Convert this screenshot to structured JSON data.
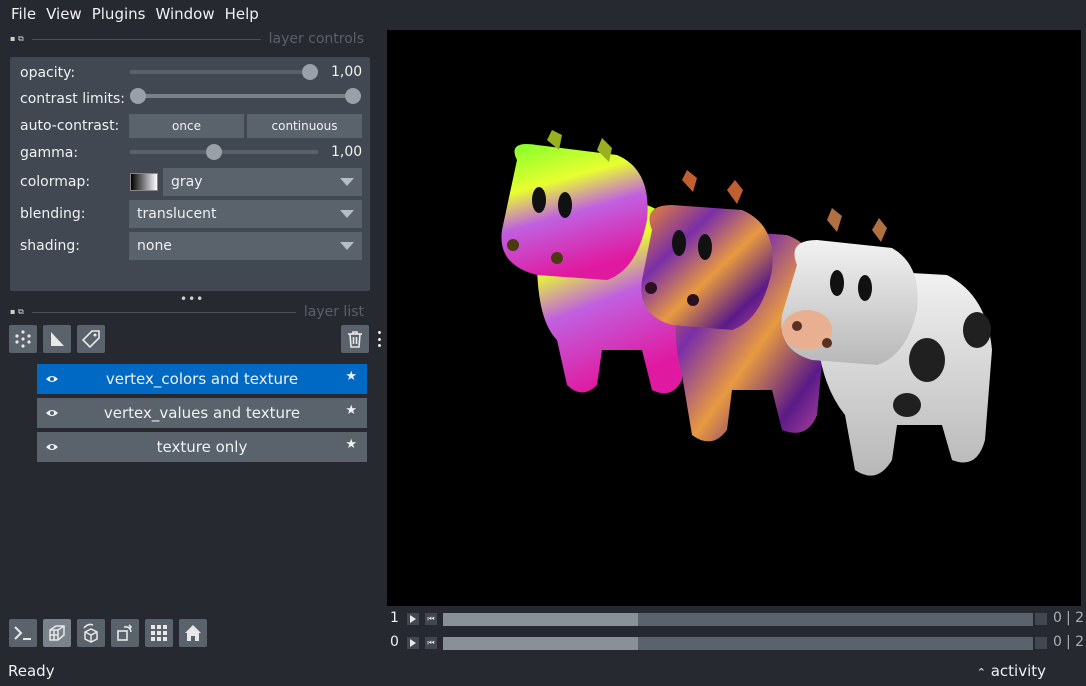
{
  "menu": [
    "File",
    "View",
    "Plugins",
    "Window",
    "Help"
  ],
  "layer_controls": {
    "title": "layer controls",
    "opacity_label": "opacity:",
    "opacity_value": "1,00",
    "opacity_level": 1.0,
    "contrast_label": "contrast limits:",
    "auto_contrast_label": "auto-contrast:",
    "once_label": "once",
    "continuous_label": "continuous",
    "gamma_label": "gamma:",
    "gamma_value": "1,00",
    "colormap_label": "colormap:",
    "colormap_value": "gray",
    "blending_label": "blending:",
    "blending_value": "translucent",
    "shading_label": "shading:",
    "shading_value": "none"
  },
  "layer_list": {
    "title": "layer list",
    "layers": [
      {
        "name": "vertex_colors and texture",
        "selected": true
      },
      {
        "name": "vertex_values and texture",
        "selected": false
      },
      {
        "name": "texture only",
        "selected": false
      }
    ]
  },
  "dims": [
    {
      "label": "1",
      "left_num": "0",
      "right_num": "2",
      "fraction": 0.33
    },
    {
      "label": "0",
      "left_num": "0",
      "right_num": "2",
      "fraction": 0.33
    }
  ],
  "status": {
    "text": "Ready",
    "activity": "activity",
    "activity_arrow": "⌃"
  },
  "icons": [
    "new-points-icon",
    "new-shapes-icon",
    "new-labels-icon",
    "delete-layer-icon",
    "console-icon",
    "ndisplay-icon",
    "roll-dims-icon",
    "transpose-dims-icon",
    "grid-icon",
    "home-icon"
  ],
  "colors": {
    "accent": "#0069c3",
    "background": "#262930",
    "panel": "#414851",
    "button": "#5a626c"
  }
}
